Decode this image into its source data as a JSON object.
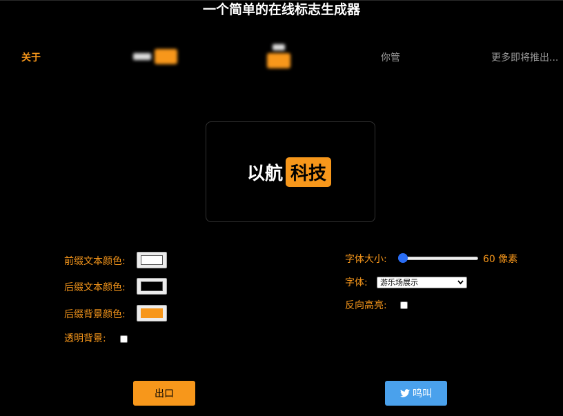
{
  "header": {
    "title": "一个简单的在线标志生成器"
  },
  "nav": {
    "items": [
      {
        "label": "关于"
      },
      {
        "label": "你管"
      },
      {
        "label": "更多即将推出..."
      }
    ]
  },
  "preview": {
    "prefix": "以航",
    "suffix": "科技"
  },
  "settings": {
    "prefix_color_label": "前缀文本颜色:",
    "prefix_color": "#ffffff",
    "suffix_color_label": "后缀文本颜色:",
    "suffix_color": "#000000",
    "suffix_bg_label": "后缀背景颜色:",
    "suffix_bg": "#f7971b",
    "transparent_label": "透明背景:",
    "transparent_checked": false,
    "font_size_label": "字体大小:",
    "font_size_value": "60 像素",
    "font_size_fraction": 0.0,
    "font_label": "字体:",
    "font_selected": "游乐场展示",
    "reverse_label": "反向高亮:",
    "reverse_checked": false
  },
  "buttons": {
    "export_label": "出口",
    "tweet_label": "鸣叫"
  },
  "colors": {
    "accent": "#f7971b",
    "twitter": "#4aa1ec",
    "slider": "#2a6df4"
  },
  "icons": {
    "tweet": "twitter-bird-icon",
    "select": "chevron-down-icon"
  }
}
